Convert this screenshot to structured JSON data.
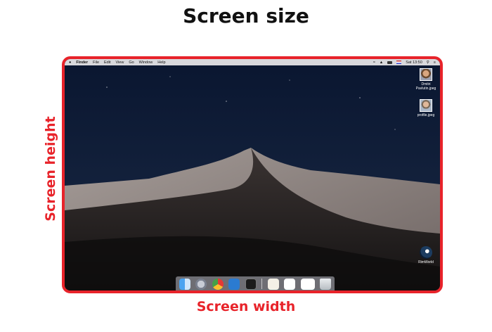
{
  "page": {
    "title": "Screen size",
    "height_label": "Screen height",
    "width_label": "Screen width",
    "frame_color": "#e8232a"
  },
  "menubar": {
    "apple_icon": "apple-icon",
    "items": [
      "Finder",
      "File",
      "Edit",
      "View",
      "Go",
      "Window",
      "Help"
    ],
    "clock": "Sat 13:50",
    "status_icons": [
      "wifi-icon",
      "volume-icon",
      "battery-icon",
      "flag-icon",
      "search-icon",
      "menu-list-icon"
    ]
  },
  "desktop": {
    "wallpaper": "desert-dunes-night",
    "icons": [
      {
        "label": "Dmitri Pavlutin.jpeg",
        "icon": "photo-file-icon"
      },
      {
        "label": "profile.jpeg",
        "icon": "photo-file-icon"
      },
      {
        "label": "RimWorld",
        "icon": "steam-icon"
      }
    ]
  },
  "dock": {
    "apps": [
      "finder-icon",
      "launchpad-icon",
      "chrome-icon",
      "vscode-icon",
      "terminal-icon",
      "preview-icon",
      "mail-document-icon",
      "blank-document-icon",
      "trash-icon"
    ]
  }
}
